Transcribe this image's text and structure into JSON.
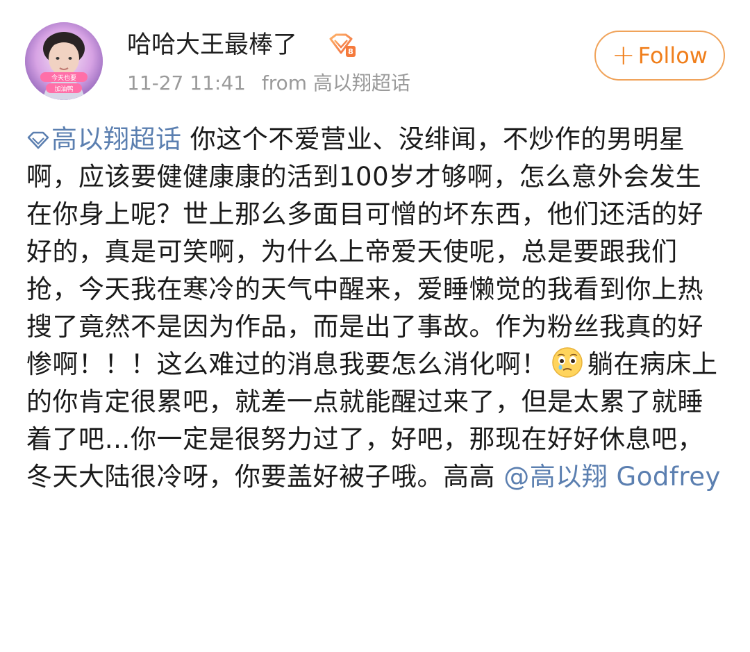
{
  "post": {
    "author": {
      "name": "哈哈大王最棒了",
      "avatar_caption": [
        "今天也要",
        "加油鸭"
      ]
    },
    "timestamp": "11-27 11:41",
    "source": "from 高以翔超话",
    "follow_label": "Follow",
    "follow_icon": "+",
    "topic": "高以翔超话",
    "text_part1": " 你这个不爱营业、没绯闻，不炒作的男明星啊，应该要健健康康的活到100岁才够啊，怎么意外会发生在你身上呢？世上那么多面目可憎的坏东西，他们还活的好好的，真是可笑啊，为什么上帝爱天使呢，总是要跟我们抢，今天我在寒冷的天气中醒来，爱睡懒觉的我看到你上热搜了竟然不是因为作品，而是出了事故。作为粉丝我真的好惨啊！！！这么难过的消息我要怎么消化啊！",
    "emoji": "teary-face",
    "text_part2": "躺在病床上的你肯定很累吧，就差一点就能醒过来了，但是太累了就睡着了吧…你一定是很努力过了，好吧，那现在好好休息吧，冬天大陆很冷呀，你要盖好被子哦。高高 ",
    "mention": "@高以翔 Godfrey",
    "colors": {
      "link": "#5b7fb0",
      "follow": "#f07f1c",
      "meta": "#9a9a9a"
    }
  }
}
